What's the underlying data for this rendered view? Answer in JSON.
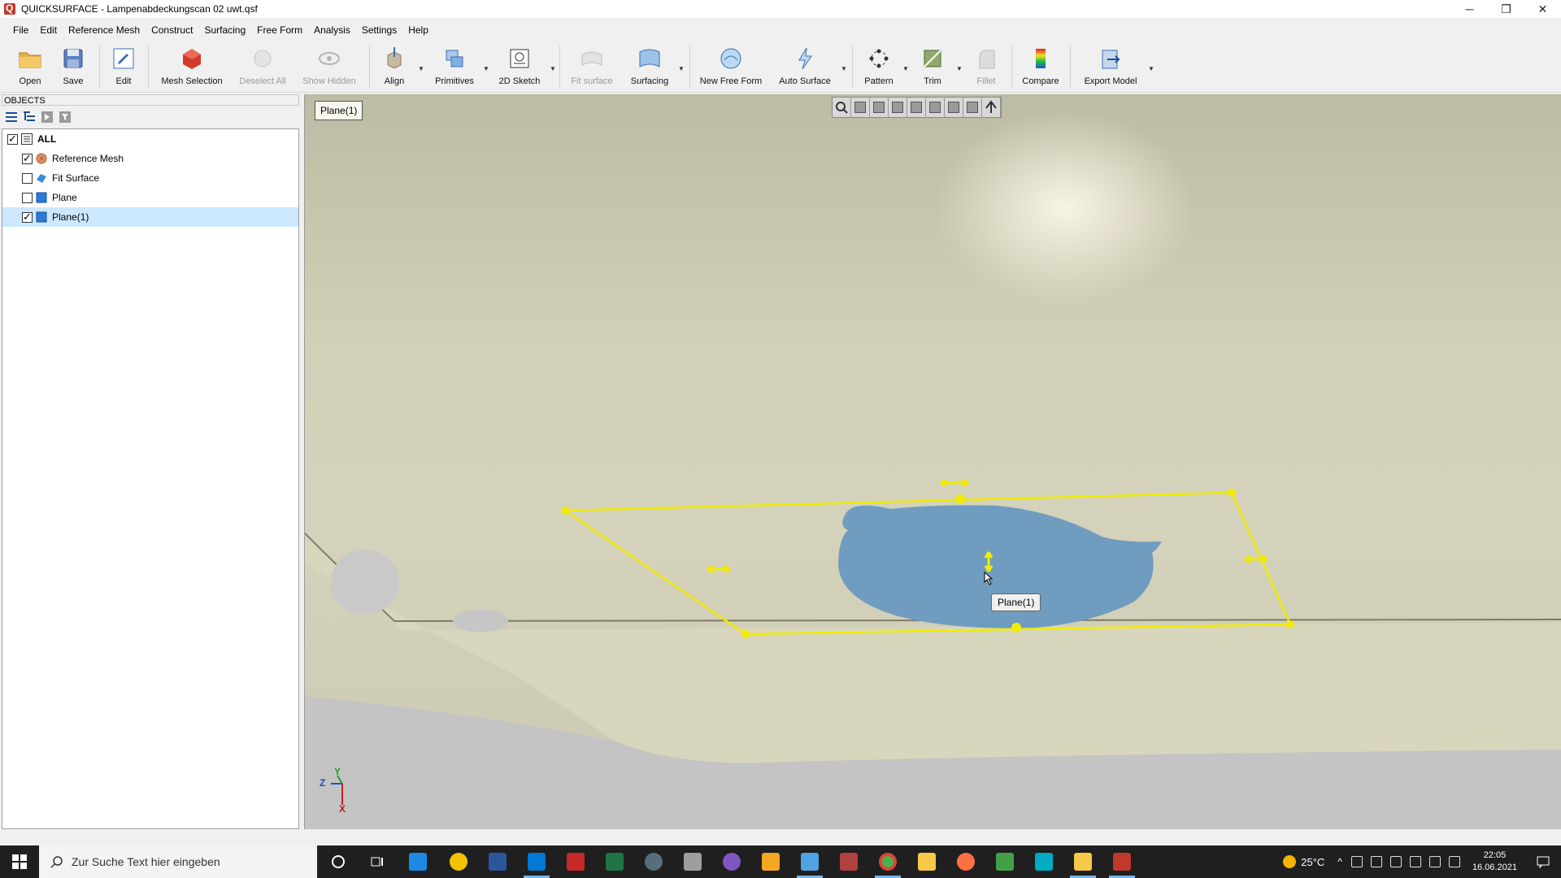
{
  "window": {
    "title": "QUICKSURFACE - Lampenabdeckungscan 02 uwt.qsf",
    "controls": {
      "minimize": "─",
      "restore": "❐",
      "close": "✕"
    }
  },
  "menu": [
    "File",
    "Edit",
    "Reference Mesh",
    "Construct",
    "Surfacing",
    "Free Form",
    "Analysis",
    "Settings",
    "Help"
  ],
  "toolbar": {
    "open": "Open",
    "save": "Save",
    "edit": "Edit",
    "mesh_selection": "Mesh Selection",
    "deselect_all": "Deselect All",
    "show_hidden": "Show Hidden",
    "align": "Align",
    "primitives": "Primitives",
    "sketch_2d": "2D Sketch",
    "fit_surface": "Fit surface",
    "surfacing": "Surfacing",
    "new_free_form": "New Free Form",
    "auto_surface": "Auto Surface",
    "pattern": "Pattern",
    "trim": "Trim",
    "fillet": "Fillet",
    "compare": "Compare",
    "export_model": "Export Model"
  },
  "objects": {
    "header": "OBJECTS",
    "tree": [
      {
        "label": "ALL",
        "checked": true
      },
      {
        "label": "Reference Mesh",
        "checked": true
      },
      {
        "label": "Fit Surface",
        "checked": false
      },
      {
        "label": "Plane",
        "checked": false
      },
      {
        "label": "Plane(1)",
        "checked": true,
        "selected": true
      }
    ]
  },
  "viewport": {
    "active_object": "Plane(1)",
    "tooltip": "Plane(1)",
    "axes": {
      "z": "Z",
      "y": "Y",
      "x": "X"
    },
    "colors": {
      "plane_outline": "#f2ec00",
      "selected_patch": "#6f9cbf",
      "mesh": "#d2d0b8"
    }
  },
  "taskbar": {
    "search_placeholder": "Zur Suche Text hier eingeben",
    "temperature": "25°C",
    "time": "22:05",
    "date": "16.06.2021"
  }
}
